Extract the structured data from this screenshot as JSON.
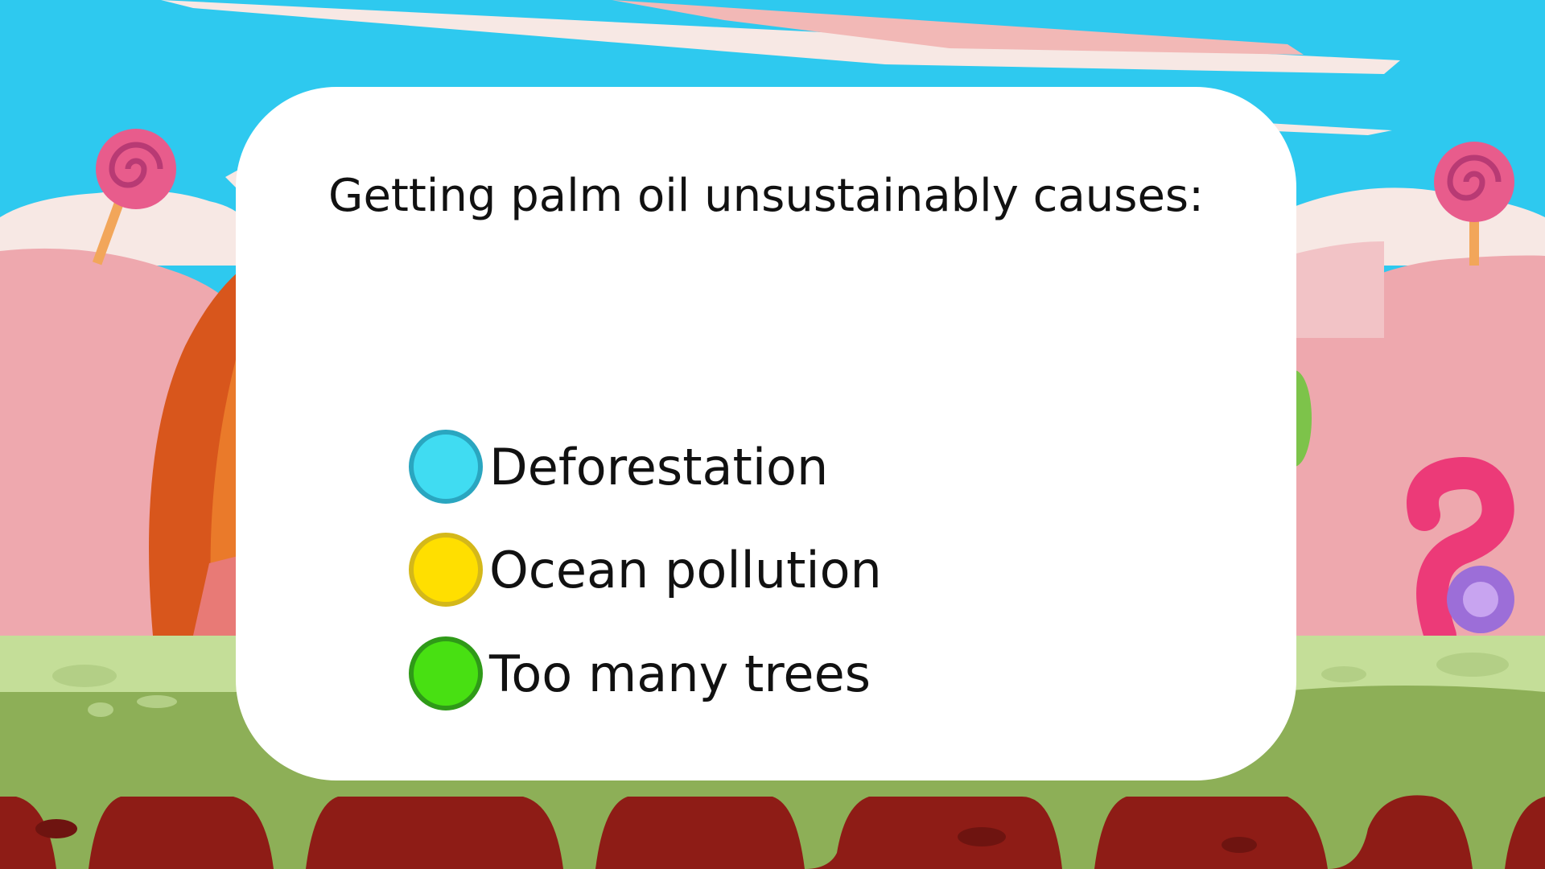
{
  "question": {
    "text": "Getting palm oil unsustainably causes:"
  },
  "options": [
    {
      "label": "Deforestation",
      "color": "#40dcf2",
      "border": "#2aa6c0"
    },
    {
      "label": "Ocean pollution",
      "color": "#ffdf00",
      "border": "#d4b81a"
    },
    {
      "label": "Too many trees",
      "color": "#48e012",
      "border": "#2f9a18"
    }
  ],
  "scene": {
    "sky_color": "#2ec9ef",
    "cloud_color": "#f7e8e4",
    "hill_color": "#eea8ae",
    "ground_color": "#8daf57",
    "ground_top_color": "#c4de98",
    "dirt_color": "#8e1c16",
    "lollipop_color": "#e85c8c"
  }
}
